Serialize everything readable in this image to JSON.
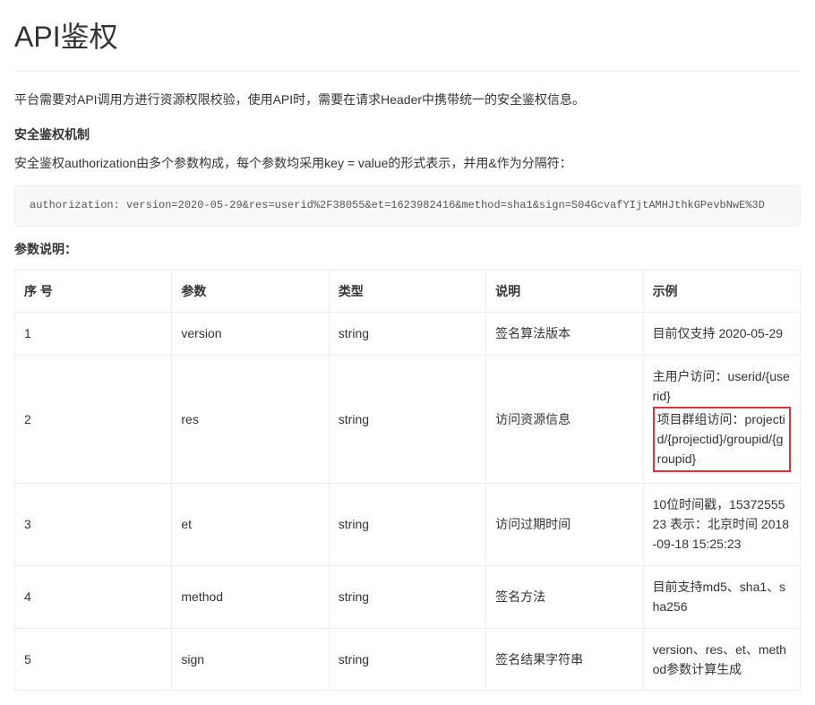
{
  "title": "API鉴权",
  "intro": "平台需要对API调用方进行资源权限校验，使用API时，需要在请求Header中携带统一的安全鉴权信息。",
  "section_title": "安全鉴权机制",
  "section_desc": "安全鉴权authorization由多个参数构成，每个参数均采用key = value的形式表示，并用&作为分隔符：",
  "code": "authorization: version=2020-05-29&res=userid%2F38055&et=1623982416&method=sha1&sign=S04GcvafYIjtAMHJthkGPevbNwE%3D",
  "params_label": "参数说明：",
  "table": {
    "headers": [
      "序 号",
      "参数",
      "类型",
      "说明",
      "示例"
    ],
    "rows": [
      {
        "seq": "1",
        "param": "version",
        "type": "string",
        "desc": "签名算法版本",
        "example": "目前仅支持 2020-05-29"
      },
      {
        "seq": "2",
        "param": "res",
        "type": "string",
        "desc": "访问资源信息",
        "example_line1": "主用户访问：userid/{userid}",
        "example_line2": "项目群组访问：projectid/{projectid}/groupid/{groupid}"
      },
      {
        "seq": "3",
        "param": "et",
        "type": "string",
        "desc": "访问过期时间",
        "example": "10位时间戳，1537255523 表示：北京时间 2018-09-18 15:25:23"
      },
      {
        "seq": "4",
        "param": "method",
        "type": "string",
        "desc": "签名方法",
        "example": "目前支持md5、sha1、sha256"
      },
      {
        "seq": "5",
        "param": "sign",
        "type": "string",
        "desc": "签名结果字符串",
        "example": "version、res、et、method参数计算生成"
      }
    ]
  }
}
